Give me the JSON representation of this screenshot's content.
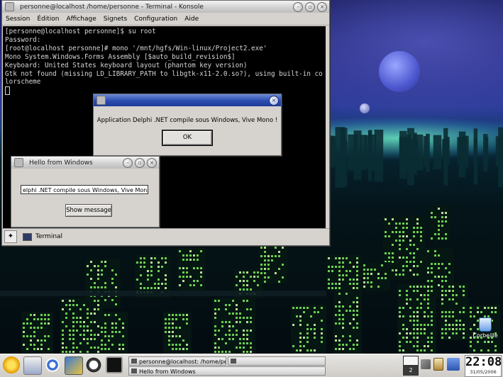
{
  "konsole": {
    "title": "personne@localhost /home/personne - Terminal - Konsole",
    "menu": [
      "Session",
      "Édition",
      "Affichage",
      "Signets",
      "Configuration",
      "Aide"
    ],
    "lines": [
      "[personne@localhost personne]$ su root",
      "Password:",
      "[root@localhost personne]# mono '/mnt/hgfs/Win-linux/Project2.exe'",
      "Mono System.Windows.Forms Assembly [$auto_build_revision$]",
      "Keyboard: United States keyboard layout (phantom key version)",
      "Gtk not found (missing LD_LIBRARY_PATH to libgtk-x11-2.0.so?), using built-in co",
      "lorscheme"
    ],
    "tab_label": "Terminal"
  },
  "msgbox": {
    "message": "Application Delphi .NET compile sous Windows, Vive Mono !",
    "ok_label": "OK"
  },
  "hello": {
    "title": "Hello from Windows",
    "input_value": "elphi .NET compile sous Windows, Vive Mono !",
    "button_label": "Show message"
  },
  "desktop": {
    "trash_label": "Corbeille"
  },
  "taskbar": {
    "items": [
      "personne@localhost: /home/per",
      "Hello from Windows"
    ],
    "pager_current": "2",
    "clock_time": "22:08",
    "clock_date": "31/05/2006"
  },
  "colors": {
    "active_titlebar": "#2b4cb0",
    "terminal_bg": "#000000",
    "window_bg": "#d6d3ce"
  }
}
